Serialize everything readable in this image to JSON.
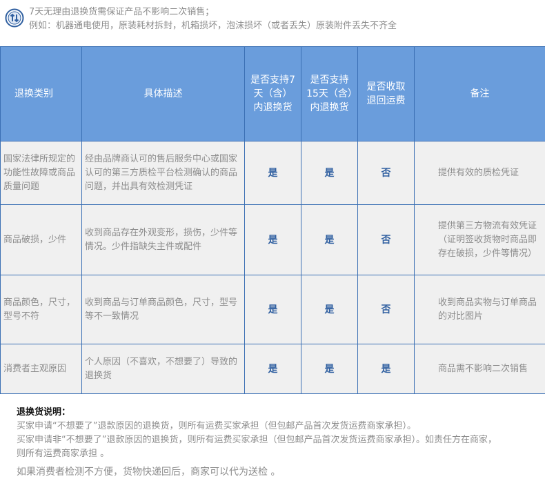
{
  "notice": {
    "line1": "7天无理由退换货需保证产品不影响二次销售；",
    "line2": "例如：机器通电使用，原装耗材拆封，机箱损坏，泡沫损坏（或者丢失）原装附件丢失不齐全"
  },
  "table": {
    "headers": {
      "category": "退换类别",
      "description": "具体描述",
      "seven_day": "是否支持7天（含）内退换货",
      "fifteen_day": "是否支持15天（含）内退换货",
      "freight": "是否收取退回运费",
      "remark": "备注"
    },
    "rows": [
      {
        "category": "国家法律所规定的功能性故障或商品质量问题",
        "description": "经由品牌商认可的售后服务中心或国家认可的第三方质检平台检测确认的商品问题，并出具有效检测凭证",
        "seven_day": "是",
        "fifteen_day": "是",
        "freight": "否",
        "remark": "提供有效的质检凭证"
      },
      {
        "category": "商品破损，少件",
        "description": "收到商品存在外观变形，损伤，少件等情况。少件指缺失主件或配件",
        "seven_day": "是",
        "fifteen_day": "是",
        "freight": "否",
        "remark": "提供第三方物流有效凭证（证明签收货物时商品即存在破损，少件等情况）"
      },
      {
        "category": "商品颜色，尺寸，型号不符",
        "description": "收到商品与订单商品颜色，尺寸，型号等不一致情况",
        "seven_day": "是",
        "fifteen_day": "是",
        "freight": "否",
        "remark": "收到商品实物与订单商品的对比图片"
      },
      {
        "category": "消费者主观原因",
        "description": "个人原因（不喜欢，不想要了）导致的退换货",
        "seven_day": "是",
        "fifteen_day": "是",
        "freight": "是",
        "remark": "商品需不影响二次销售"
      }
    ]
  },
  "explanation": {
    "title": "退换货说明：",
    "line1": "买家申请“不想要了”退款原因的退换货，则所有运费买家承担（但包邮产品首次发货运费商家承担）。",
    "line2": "买家申请非“不想要了”退款原因的退换货，则所有运费买家承担（但包邮产品首次发货运费商家承担）。如责任方在商家，",
    "line3": "则所有运费商家承担 。",
    "line4": "如果消费者检测不方便，货物快递回后，商家可以代为送检 。"
  },
  "icon": {
    "name": "refresh-circle-icon",
    "color": "#2f5fa0"
  }
}
